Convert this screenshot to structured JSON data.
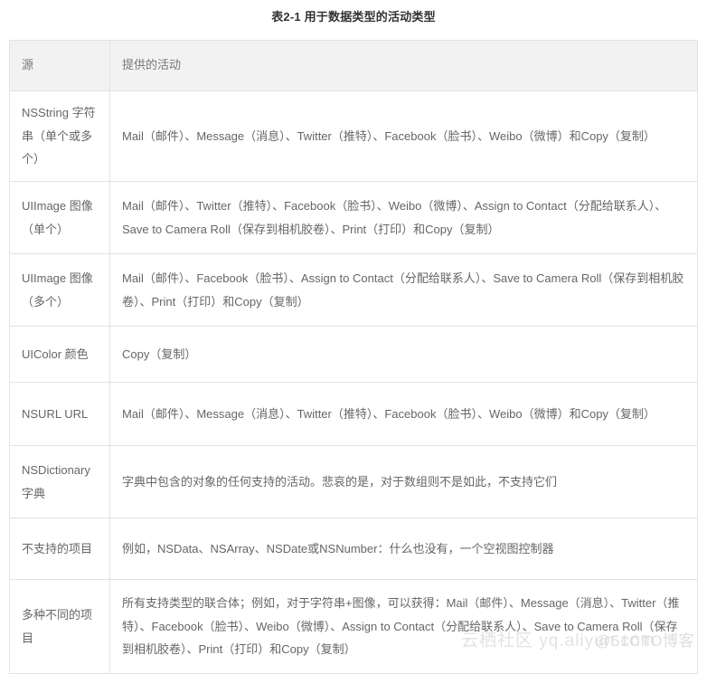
{
  "document": {
    "caption": "表2-1 用于数据类型的活动类型",
    "caption_color": "#333333",
    "text_color": "#666666",
    "border_color": "#e2e2e2",
    "header_background": "#f2f2f2"
  },
  "table": {
    "columns": [
      {
        "key": "source",
        "label": "源"
      },
      {
        "key": "activities",
        "label": "提供的活动"
      }
    ],
    "rows": [
      {
        "source": "NSString 字符串（单个或多个）",
        "activities": "Mail（邮件）、Message（消息）、Twitter（推特）、Facebook（脸书）、Weibo（微博）和Copy（复制）"
      },
      {
        "source": "UIImage 图像（单个）",
        "activities": "Mail（邮件）、Twitter（推特）、Facebook（脸书）、Weibo（微博）、Assign to Contact（分配给联系人）、Save to Camera Roll（保存到相机胶卷）、Print（打印）和Copy（复制）"
      },
      {
        "source": "UIImage 图像（多个）",
        "activities": "Mail（邮件）、Facebook（脸书）、Assign to Contact（分配给联系人）、Save to Camera Roll（保存到相机胶卷）、Print（打印）和Copy（复制）"
      },
      {
        "source": "UIColor 颜色",
        "activities": "Copy（复制）"
      },
      {
        "source": "NSURL URL",
        "activities": "Mail（邮件）、Message（消息）、Twitter（推特）、Facebook（脸书）、Weibo（微博）和Copy（复制）"
      },
      {
        "source": "NSDictionary 字典",
        "activities": "字典中包含的对象的任何支持的活动。悲哀的是，对于数组则不是如此，不支持它们"
      },
      {
        "source": "不支持的项目",
        "activities": "例如，NSData、NSArray、NSDate或NSNumber：什么也没有，一个空视图控制器"
      },
      {
        "source": "多种不同的项目",
        "activities": "所有支持类型的联合体；例如，对于字符串+图像，可以获得：Mail（邮件）、Message（消息）、Twitter（推特）、Facebook（脸书）、Weibo（微博）、Assign to Contact（分配给联系人）、Save to Camera Roll（保存到相机胶卷）、Print（打印）和Copy（复制）"
      }
    ]
  },
  "watermark": {
    "primary": "云栖社区 yq.aliyun.com",
    "secondary": "@51CTO博客"
  }
}
